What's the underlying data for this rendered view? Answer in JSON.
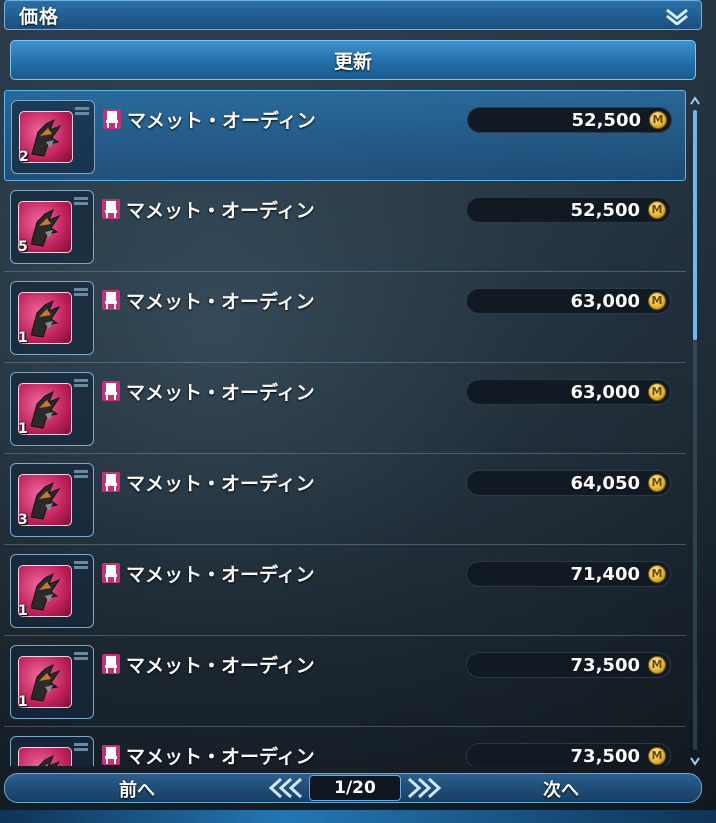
{
  "sort": {
    "label": "価格"
  },
  "refresh": {
    "label": "更新"
  },
  "listings": [
    {
      "name": "マメット・オーディン",
      "quantity": "2",
      "price": "52,500",
      "selected": true
    },
    {
      "name": "マメット・オーディン",
      "quantity": "5",
      "price": "52,500",
      "selected": false
    },
    {
      "name": "マメット・オーディン",
      "quantity": "1",
      "price": "63,000",
      "selected": false
    },
    {
      "name": "マメット・オーディン",
      "quantity": "1",
      "price": "63,000",
      "selected": false
    },
    {
      "name": "マメット・オーディン",
      "quantity": "3",
      "price": "64,050",
      "selected": false
    },
    {
      "name": "マメット・オーディン",
      "quantity": "1",
      "price": "71,400",
      "selected": false
    },
    {
      "name": "マメット・オーディン",
      "quantity": "1",
      "price": "73,500",
      "selected": false
    },
    {
      "name": "マメット・オーディン",
      "quantity": "",
      "price": "73,500",
      "selected": false
    }
  ],
  "currency_icon": "meseta-coin-icon",
  "currency_symbol": "M",
  "pager": {
    "prev_label": "前へ",
    "next_label": "次へ",
    "page_display": "1/20"
  },
  "colors": {
    "accent": "#2b6fa6",
    "item_tile": "#c0225c",
    "coin": "#e6b62f"
  }
}
